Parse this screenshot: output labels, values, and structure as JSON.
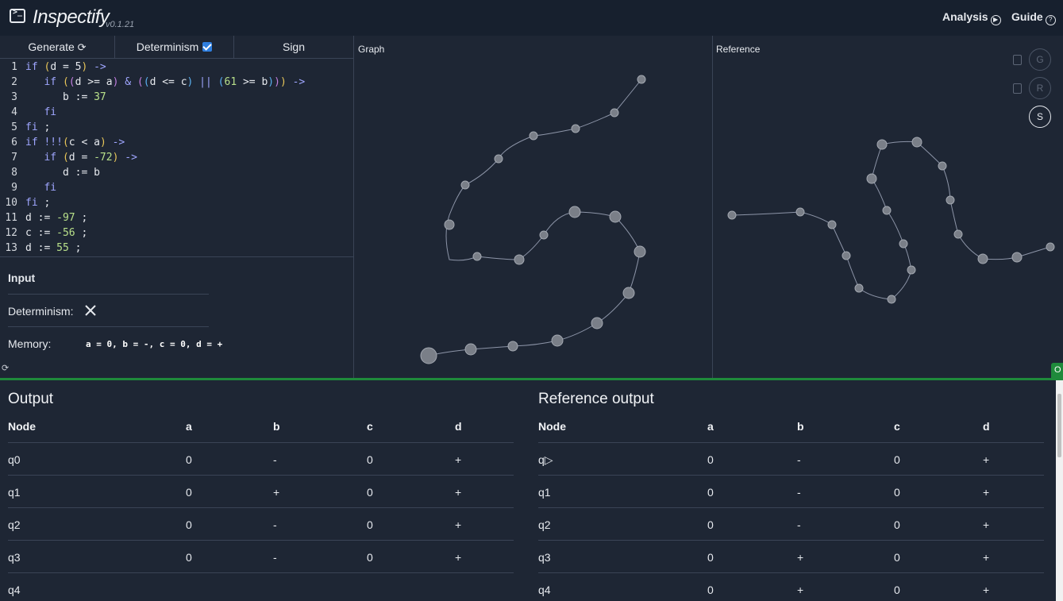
{
  "app": {
    "title": "Inspectify",
    "version": "v0.1.21",
    "terminal_glyph": ">_"
  },
  "nav": {
    "analysis": "Analysis",
    "guide": "Guide",
    "analysis_icon": "play-circle-icon",
    "guide_icon": "question-circle-icon"
  },
  "tabs": {
    "generate": "Generate",
    "generate_icon": "refresh-icon",
    "determinism": "Determinism",
    "determinism_checked": true,
    "sign": "Sign"
  },
  "code_lines": [
    {
      "n": "1"
    },
    {
      "n": "2"
    },
    {
      "n": "3"
    },
    {
      "n": "4"
    },
    {
      "n": "5"
    },
    {
      "n": "6"
    },
    {
      "n": "7"
    },
    {
      "n": "8"
    },
    {
      "n": "9"
    },
    {
      "n": "10"
    },
    {
      "n": "11"
    },
    {
      "n": "12"
    },
    {
      "n": "13"
    }
  ],
  "code": {
    "l1": [
      "if",
      "(",
      "d = 5",
      ")",
      " ->"
    ],
    "l2": [
      "if",
      "(",
      "(",
      "d >= a",
      ")",
      " & ",
      "(",
      "(",
      "d <= c",
      ")",
      " || ",
      "(",
      "61",
      " >= b",
      ")",
      ")",
      ")",
      " ->"
    ],
    "l3": [
      "b := ",
      "37"
    ],
    "l4": [
      "fi"
    ],
    "l5": [
      "fi",
      " ;"
    ],
    "l6": [
      "if",
      " !!!",
      "(",
      "c < a",
      ")",
      " ->"
    ],
    "l7": [
      "if",
      "(",
      "d = ",
      "-72",
      ")",
      " ->"
    ],
    "l8": [
      "d := b"
    ],
    "l9": [
      "fi"
    ],
    "l10": [
      "fi",
      " ;"
    ],
    "l11": [
      "d := ",
      "-97",
      " ;"
    ],
    "l12": [
      "c := ",
      "-56",
      " ;"
    ],
    "l13": [
      "d := ",
      "55",
      " ;"
    ]
  },
  "input": {
    "title": "Input",
    "determinism_label": "Determinism:",
    "determinism_value_icon": "x-icon",
    "memory_label": "Memory:",
    "memory_value": "a = 0, b = -, c = 0, d = +"
  },
  "graph": {
    "title": "Graph"
  },
  "reference": {
    "title": "Reference",
    "btn_g": "G",
    "btn_r": "R",
    "btn_s": "S"
  },
  "output": {
    "title": "Output",
    "headers": [
      "Node",
      "a",
      "b",
      "c",
      "d"
    ],
    "rows": [
      [
        "q0",
        "0",
        "-",
        "0",
        "+"
      ],
      [
        "q1",
        "0",
        "+",
        "0",
        "+"
      ],
      [
        "q2",
        "0",
        "-",
        "0",
        "+"
      ],
      [
        "q3",
        "0",
        "-",
        "0",
        "+"
      ],
      [
        "q4",
        "",
        "",
        "",
        ""
      ]
    ]
  },
  "reference_output": {
    "title": "Reference output",
    "headers": [
      "Node",
      "a",
      "b",
      "c",
      "d"
    ],
    "rows": [
      [
        "q▷",
        "0",
        "-",
        "0",
        "+"
      ],
      [
        "q1",
        "0",
        "-",
        "0",
        "+"
      ],
      [
        "q2",
        "0",
        "-",
        "0",
        "+"
      ],
      [
        "q3",
        "0",
        "+",
        "0",
        "+"
      ],
      [
        "q4",
        "0",
        "+",
        "0",
        "+"
      ]
    ]
  },
  "badge": "O",
  "colors": {
    "accent_green": "#1f8a3b",
    "checkbox_blue": "#2f7fe0",
    "keyword": "#9fa6ff",
    "number": "#b8e08a"
  }
}
